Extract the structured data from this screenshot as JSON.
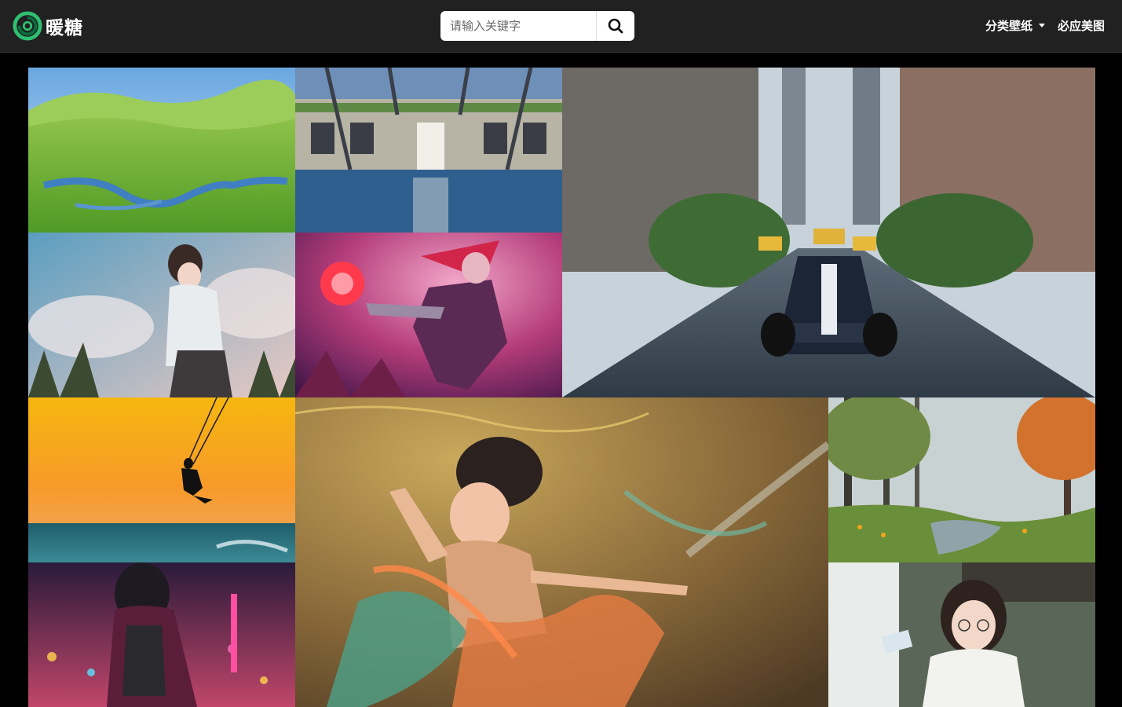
{
  "header": {
    "logo_text": "暖糖",
    "search_placeholder": "请输入关键字",
    "nav": [
      {
        "label": "分类壁纸",
        "has_dropdown": true
      },
      {
        "label": "必应美图",
        "has_dropdown": false
      }
    ]
  },
  "colors": {
    "header_bg": "#212121",
    "page_bg": "#000000",
    "logo_green": "#2fbf71"
  },
  "icons": {
    "search": "search-icon",
    "logo": "spiral-logo-icon",
    "dropdown": "caret-down-icon"
  }
}
